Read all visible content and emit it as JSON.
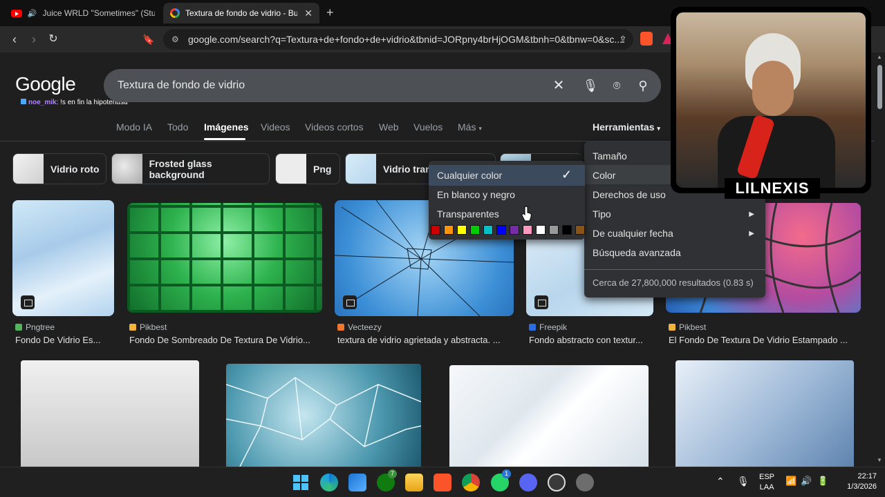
{
  "browser": {
    "tabs": [
      {
        "label": "Juice WRLD \"Sometimes\" (Studio"
      },
      {
        "label": "Textura de fondo de vidrio - Busc"
      }
    ],
    "url": "google.com/search?q=Textura+de+fondo+de+vidrio&tbnid=JORpny4brHjOGM&tbnh=0&tbnw=0&sc..."
  },
  "google": {
    "logo": "Google",
    "query": "Textura de fondo de vidrio",
    "chat_user": "noe_mik",
    "chat_message": ": !s en fin la hipotenusa",
    "nav": [
      "Modo IA",
      "Todo",
      "Imágenes",
      "Videos",
      "Videos cortos",
      "Web",
      "Vuelos",
      "Más"
    ],
    "tools_label": "Herramientas",
    "chips": [
      "Vidrio roto",
      "Frosted glass background",
      "Png",
      "Vidrio tran"
    ]
  },
  "results": [
    {
      "source": "Pngtree",
      "title": "Fondo De Vidrio Es..."
    },
    {
      "source": "Pikbest",
      "title": "Fondo De Sombreado De Textura De Vidrio..."
    },
    {
      "source": "Vecteezy",
      "title": "textura de vidrio agrietada y abstracta. ..."
    },
    {
      "source": "Freepik",
      "title": "Fondo abstracto con textur..."
    },
    {
      "source": "Pikbest",
      "title": "El Fondo De Textura De Vidrio Estampado ..."
    }
  ],
  "tools_menu": {
    "items": [
      "Tamaño",
      "Color",
      "Derechos de uso",
      "Tipo",
      "De cualquier fecha",
      "Búsqueda avanzada"
    ],
    "results_info": "Cerca de 27,800,000 resultados (0.83 s)"
  },
  "color_menu": {
    "items": [
      "Cualquier color",
      "En blanco y negro",
      "Transparentes"
    ],
    "swatches": [
      "#cc0000",
      "#fb940b",
      "#ffff00",
      "#00cc00",
      "#03c0c6",
      "#0000ff",
      "#762ca7",
      "#ff98bf",
      "#ffffff",
      "#999999",
      "#000000",
      "#885418"
    ]
  },
  "webcam": {
    "name": "LILNEXIS"
  },
  "taskbar": {
    "lang_top": "ESP",
    "lang_bottom": "LAA",
    "time": "22:17",
    "date": "1/3/2026",
    "xbox_badge": "7",
    "whatsapp_badge": "1"
  }
}
